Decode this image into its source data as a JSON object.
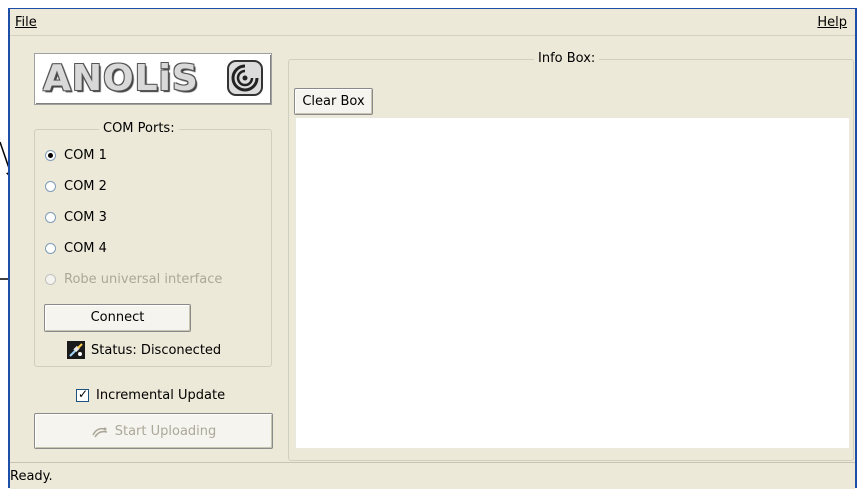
{
  "menu": {
    "file_label": "File",
    "help_label": "Help"
  },
  "logo": {
    "text": "ANOLiS"
  },
  "com_ports": {
    "title": "COM Ports:",
    "options": [
      {
        "label": "COM 1",
        "checked": true,
        "disabled": false
      },
      {
        "label": "COM 2",
        "checked": false,
        "disabled": false
      },
      {
        "label": "COM 3",
        "checked": false,
        "disabled": false
      },
      {
        "label": "COM 4",
        "checked": false,
        "disabled": false
      },
      {
        "label": "Robe universal interface",
        "checked": false,
        "disabled": true
      }
    ],
    "connect_label": "Connect",
    "status_text": "Status: Disconected"
  },
  "incremental_update": {
    "label": "Incremental Update",
    "checked": true
  },
  "upload": {
    "label": "Start Uploading",
    "disabled": true
  },
  "info_box": {
    "title": "Info Box:",
    "clear_label": "Clear Box",
    "content": ""
  },
  "statusbar": {
    "text": "Ready."
  },
  "colors": {
    "window_border": "#1d4ea8",
    "face": "#ece9d8",
    "disabled_text": "#aca899"
  }
}
